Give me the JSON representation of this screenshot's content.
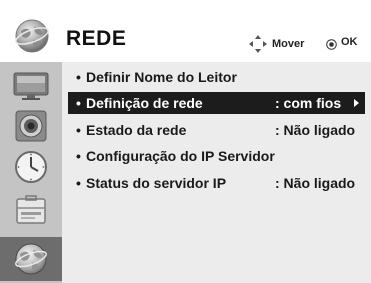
{
  "header": {
    "title": "REDE",
    "move_label": "Mover",
    "ok_label": "OK"
  },
  "sidebar": {
    "items": [
      {
        "icon": "monitor-icon"
      },
      {
        "icon": "speaker-icon"
      },
      {
        "icon": "clock-icon"
      },
      {
        "icon": "toolbox-icon"
      },
      {
        "icon": "network-globe-icon",
        "selected": true
      }
    ]
  },
  "menu": {
    "items": [
      {
        "label": "Definir Nome do Leitor",
        "value": ""
      },
      {
        "label": "Definição de rede",
        "value": ": com fios",
        "selected": true
      },
      {
        "label": "Estado da rede",
        "value": ": Não ligado"
      },
      {
        "label": "Configuração do IP Servidor",
        "value": ""
      },
      {
        "label": "Status do servidor IP",
        "value": ": Não ligado"
      }
    ]
  },
  "colors": {
    "sidebar_bg": "#c4c4c4",
    "sidebar_selected_bg": "#6d6d6d",
    "content_bg": "#ececec",
    "selected_row_bg": "#1c1c1c"
  }
}
